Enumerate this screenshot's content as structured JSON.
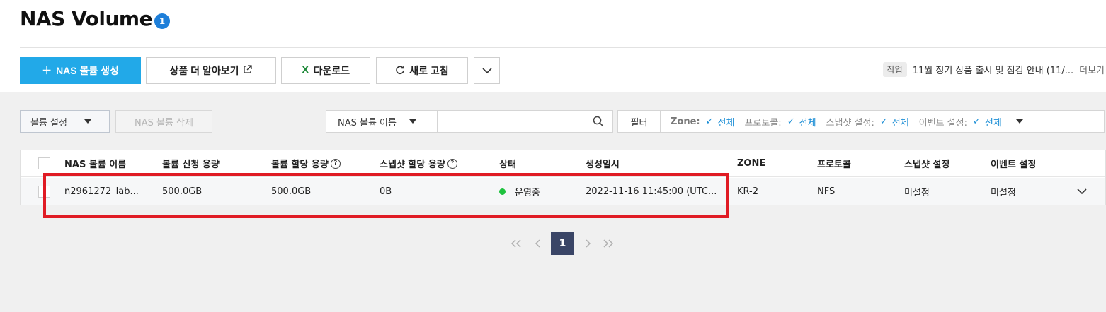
{
  "page": {
    "title": "NAS Volume",
    "count_badge": "1"
  },
  "toolbar": {
    "create_label": "NAS 볼륨 생성",
    "learn_more_label": "상품 더 알아보기",
    "download_label": "다운로드",
    "refresh_label": "새로 고침"
  },
  "notice": {
    "tag": "작업",
    "text": "11월 정기 상품 출시 및 점검 안내 (11/...",
    "more": "더보기"
  },
  "actions": {
    "volume_settings": "볼륨 설정",
    "delete_volume": "NAS 볼륨 삭제"
  },
  "search": {
    "field": "NAS 볼륨 이름",
    "placeholder": ""
  },
  "filter": {
    "label": "필터",
    "items": [
      {
        "key": "Zone:",
        "value": "전체"
      },
      {
        "key": "프로토콜:",
        "value": "전체"
      },
      {
        "key": "스냅샷 설정:",
        "value": "전체"
      },
      {
        "key": "이벤트 설정:",
        "value": "전체"
      }
    ]
  },
  "table": {
    "headers": [
      "NAS 볼륨 이름",
      "볼륨 신청 용량",
      "볼륨 할당 용량",
      "스냅샷 할당 용량",
      "상태",
      "생성일시",
      "ZONE",
      "프로토콜",
      "스냅샷 설정",
      "이벤트 설정"
    ],
    "rows": [
      {
        "name": "n2961272_lab...",
        "requested": "500.0GB",
        "allocated": "500.0GB",
        "snapshot": "0B",
        "status": "운영중",
        "created": "2022-11-16 11:45:00 (UTC...",
        "zone": "KR-2",
        "protocol": "NFS",
        "snapshot_setting": "미설정",
        "event_setting": "미설정"
      }
    ]
  },
  "pagination": {
    "current": "1"
  },
  "colors": {
    "primary": "#22a9e8",
    "status_running": "#1ec23e",
    "highlight": "#e01b24",
    "page_active": "#3a4566"
  }
}
